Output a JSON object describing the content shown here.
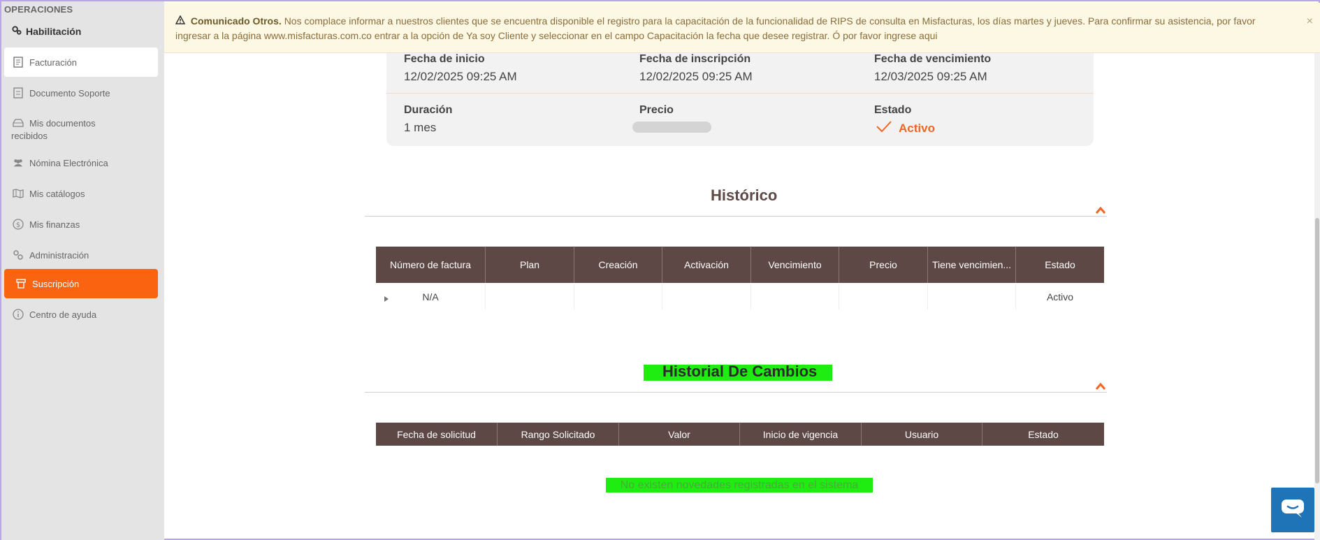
{
  "sidebar": {
    "section": "OPERACIONES",
    "group": "Habilitación",
    "items": [
      {
        "label": "Facturación",
        "icon": "invoice-icon"
      },
      {
        "label": "Documento Soporte",
        "icon": "document-icon"
      },
      {
        "label": "Mis documentos recibidos",
        "icon": "inbox-icon"
      },
      {
        "label": "Nómina Electrónica",
        "icon": "users-icon"
      },
      {
        "label": "Mis catálogos",
        "icon": "map-icon"
      },
      {
        "label": "Mis finanzas",
        "icon": "dollar-icon"
      },
      {
        "label": "Administración",
        "icon": "cogs-icon"
      },
      {
        "label": "Suscripción",
        "icon": "subscription-icon"
      },
      {
        "label": "Centro de ayuda",
        "icon": "info-icon"
      }
    ]
  },
  "banner": {
    "title": "Comunicado Otros.",
    "text": "Nos complace informar a nuestros clientes que se encuentra disponible el registro para la capacitación de la funcionalidad de RIPS de consulta en Misfacturas, los días martes y jueves. Para confirmar su asistencia, por favor ingresar a la página www.misfacturas.com.co entrar a la opción de Ya soy Cliente y seleccionar en el campo Capacitación la fecha que desee registrar. Ó por favor ingrese aqui",
    "close": "×"
  },
  "summary": {
    "fecha_inicio_label": "Fecha de inicio",
    "fecha_inicio": "12/02/2025 09:25 AM",
    "fecha_inscripcion_label": "Fecha de inscripción",
    "fecha_inscripcion": "12/02/2025 09:25 AM",
    "fecha_vencimiento_label": "Fecha de vencimiento",
    "fecha_vencimiento": "12/03/2025 09:25 AM",
    "duracion_label": "Duración",
    "duracion": "1 mes",
    "precio_label": "Precio",
    "estado_label": "Estado",
    "estado": "Activo"
  },
  "historico": {
    "title": "Histórico",
    "columns": [
      "Número de factura",
      "Plan",
      "Creación",
      "Activación",
      "Vencimiento",
      "Precio",
      "Tiene vencimien...",
      "Estado"
    ],
    "row": {
      "numero": "N/A",
      "estado": "Activo"
    }
  },
  "cambios": {
    "title": "Historial De Cambios",
    "columns": [
      "Fecha de solicitud",
      "Rango Solicitado",
      "Valor",
      "Inicio de vigencia",
      "Usuario",
      "Estado"
    ],
    "empty": "No existen novedades registradas en el sistema"
  },
  "colors": {
    "accent": "#fa6410",
    "table_header": "#5e4845",
    "highlight": "#1fed11",
    "chat": "#1f73b7"
  }
}
